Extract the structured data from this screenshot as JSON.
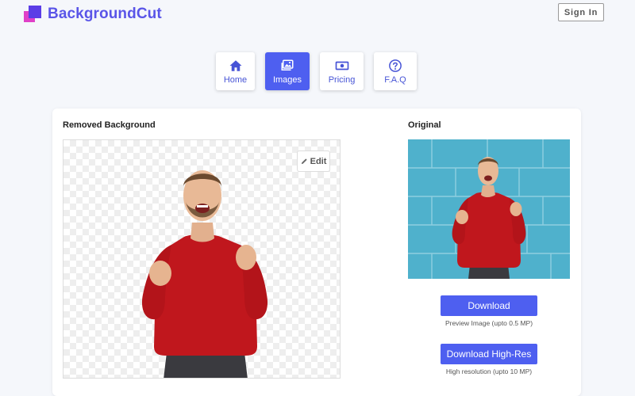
{
  "header": {
    "logo_icon": "logo-squares-icon",
    "brand": "BackgroundCut",
    "signin_label": "Sign In"
  },
  "nav": {
    "tabs": [
      {
        "label": "Home",
        "icon": "home-icon"
      },
      {
        "label": "Images",
        "icon": "images-icon",
        "active": true
      },
      {
        "label": "Pricing",
        "icon": "money-icon"
      },
      {
        "label": "F.A.Q",
        "icon": "question-circle-icon"
      }
    ]
  },
  "main": {
    "removed_heading": "Removed Background",
    "original_heading": "Original",
    "edit_label": "Edit",
    "download_label": "Download",
    "download_caption": "Preview Image (upto 0.5 MP)",
    "download_hr_label": "Download High-Res",
    "download_hr_caption": "High resolution (upto 10 MP)"
  },
  "colors": {
    "accent": "#4e5ff0",
    "brand_text": "#5a55e8",
    "sweater": "#c0171d",
    "wall": "#4fb1cc"
  }
}
